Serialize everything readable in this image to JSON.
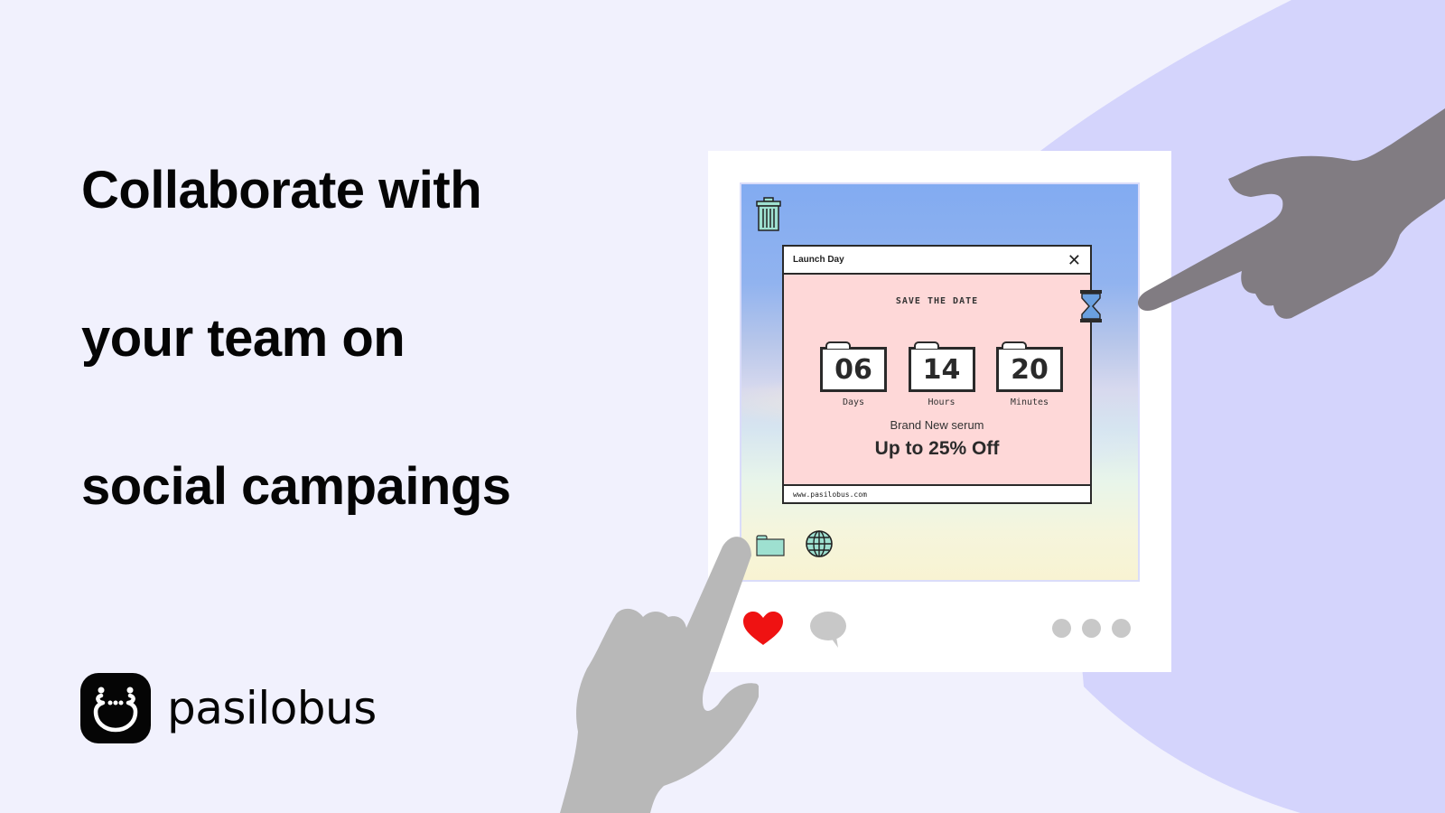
{
  "headline": {
    "lines": [
      "Collaborate with",
      "your team on",
      "social campaings"
    ]
  },
  "brand": {
    "name": "pasilobus",
    "logo_icon": "smiley-face-icon"
  },
  "colors": {
    "background": "#f1f1fd",
    "blob": "#d4d4fc",
    "popup_bg": "#fed8d8",
    "heart": "#ef1212",
    "hand_dark": "#817c82",
    "hand_light": "#b8b8b8",
    "icon_teal": "#9ee0d0",
    "icon_blue": "#6aa0e0"
  },
  "post": {
    "popup": {
      "title": "Launch Day",
      "close_icon": "close-icon",
      "eyebrow": "SAVE THE DATE",
      "countdown": [
        {
          "value": "06",
          "label": "Days"
        },
        {
          "value": "14",
          "label": "Hours"
        },
        {
          "value": "20",
          "label": "Minutes"
        }
      ],
      "subtitle": "Brand New serum",
      "offer": "Up to 25% Off",
      "url": "www.pasilobus.com"
    },
    "desktop_icons": [
      "trash-icon",
      "hourglass-icon",
      "folder-icon",
      "globe-icon"
    ],
    "actions": {
      "like_icon": "heart-icon",
      "comment_icon": "comment-icon",
      "more_icon": "more-dots-icon"
    }
  }
}
